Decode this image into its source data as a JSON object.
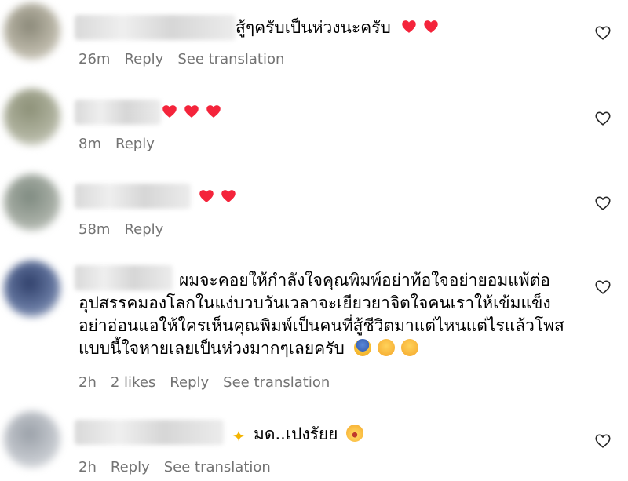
{
  "comments": [
    {
      "text": "สู้ๆครับเป็นห่วงนะครับ",
      "emojis": [
        "heart",
        "heart"
      ],
      "time": "26m",
      "likes": "",
      "reply": "Reply",
      "translate": "See translation"
    },
    {
      "text": "",
      "emojis": [
        "heart",
        "heart",
        "heart"
      ],
      "time": "8m",
      "likes": "",
      "reply": "Reply",
      "translate": ""
    },
    {
      "text": "",
      "emojis": [
        "heart",
        "heart"
      ],
      "time": "58m",
      "likes": "",
      "reply": "Reply",
      "translate": ""
    },
    {
      "lines": [
        "ผมจะคอยให้กำลังใจคุณพิมพ์อย่าท้อใจอย่ายอมแพ้ต่อ",
        "อุปสรรคมองโลกในแง่บวบวันเวลาจะเยียวยาจิตใจคนเราให้เข้มแข็ง",
        "อย่าอ่อนแอให้ใครเห็นคุณพิมพ์เป็นคนที่สู้ชีวิตมาแต่ไหนแต่ไรแล้วโพส",
        "แบบนี้ใจหายเลยเป็นห่วงมากๆเลยครับ"
      ],
      "emojis": [
        "scream",
        "pensive",
        "pleading"
      ],
      "time": "2h",
      "likes": "2 likes",
      "reply": "Reply",
      "translate": "See translation"
    },
    {
      "text": "มด..เปงรัยย",
      "emojis_before": [
        "sparkles"
      ],
      "emojis": [
        "scream"
      ],
      "time": "2h",
      "likes": "",
      "reply": "Reply",
      "translate": "See translation"
    }
  ],
  "colors": {
    "meta": "#737373",
    "heart": "#f4243b"
  },
  "icons": [
    "heart-outline-icon"
  ]
}
